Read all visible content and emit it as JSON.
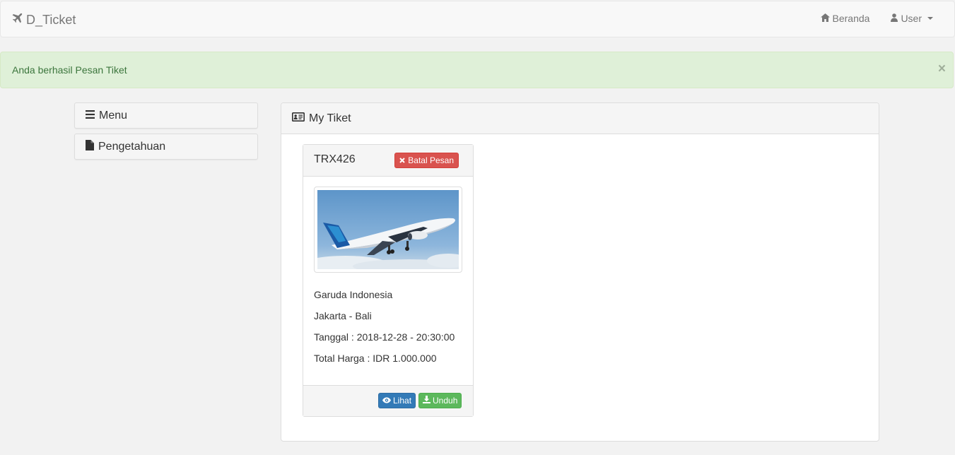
{
  "navbar": {
    "brand": "D_Ticket",
    "brand_icon": "plane-icon",
    "links": [
      {
        "label": "Beranda",
        "icon": "home-icon"
      },
      {
        "label": "User",
        "icon": "user-icon"
      }
    ]
  },
  "alert": {
    "message": "Anda berhasil Pesan Tiket",
    "close": "×"
  },
  "sidebar": {
    "items": [
      {
        "label": "Menu",
        "icon": "bars-icon"
      },
      {
        "label": "Pengetahuan",
        "icon": "file-icon"
      }
    ]
  },
  "panel": {
    "title": "My Tiket",
    "icon": "id-card-icon"
  },
  "ticket": {
    "code": "TRX426",
    "cancel_label": "Batal Pesan",
    "airline": "Garuda Indonesia",
    "route": "Jakarta - Bali",
    "date": "Tanggal : 2018-12-28 - 20:30:00",
    "price": "Total Harga : IDR 1.000.000",
    "view_label": "Lihat",
    "download_label": "Unduh"
  },
  "colors": {
    "danger": "#d9534f",
    "primary": "#337ab7",
    "success": "#5cb85c",
    "alert_bg": "#dff0d8"
  }
}
